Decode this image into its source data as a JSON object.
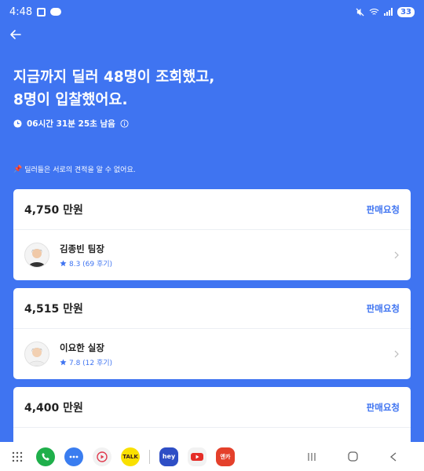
{
  "status_bar": {
    "time": "4:48",
    "battery": "33"
  },
  "headline": {
    "line1": "지금까지 딜러 48명이 조회했고,",
    "line2": "8명이 입찰했어요."
  },
  "timer": {
    "text": "06시간 31분 25초 남음"
  },
  "note": {
    "emoji": "📌",
    "text": "딜러들은 서로의 견적을 알 수 없어요."
  },
  "bids": [
    {
      "price": "4,750 만원",
      "action": "판매요청",
      "dealer": "김종빈 팀장",
      "rating": "8.3 (69 후기)"
    },
    {
      "price": "4,515 만원",
      "action": "판매요청",
      "dealer": "이요한 실장",
      "rating": "7.8 (12 후기)"
    },
    {
      "price": "4,400 만원",
      "action": "판매요청"
    }
  ],
  "dock": {
    "apps": [
      {
        "icon": "app-drawer-icon"
      },
      {
        "icon": "phone-icon",
        "color": "#1faf4b"
      },
      {
        "icon": "messages-icon",
        "color": "#3a7df0"
      },
      {
        "icon": "screen-recorder-icon",
        "color": "#e8e8e8"
      },
      {
        "icon": "kakaotalk-icon",
        "label": "TALK",
        "color": "#f9e000"
      },
      {
        "icon": "hey-icon",
        "label": "hey",
        "color": "#2e4ec5"
      },
      {
        "icon": "youtube-icon",
        "color": "#f2f2f2"
      },
      {
        "icon": "encar-icon",
        "label": "엔카",
        "color": "#e4402b"
      }
    ]
  },
  "colors": {
    "accent": "#3f74f1",
    "card": "#ffffff"
  }
}
